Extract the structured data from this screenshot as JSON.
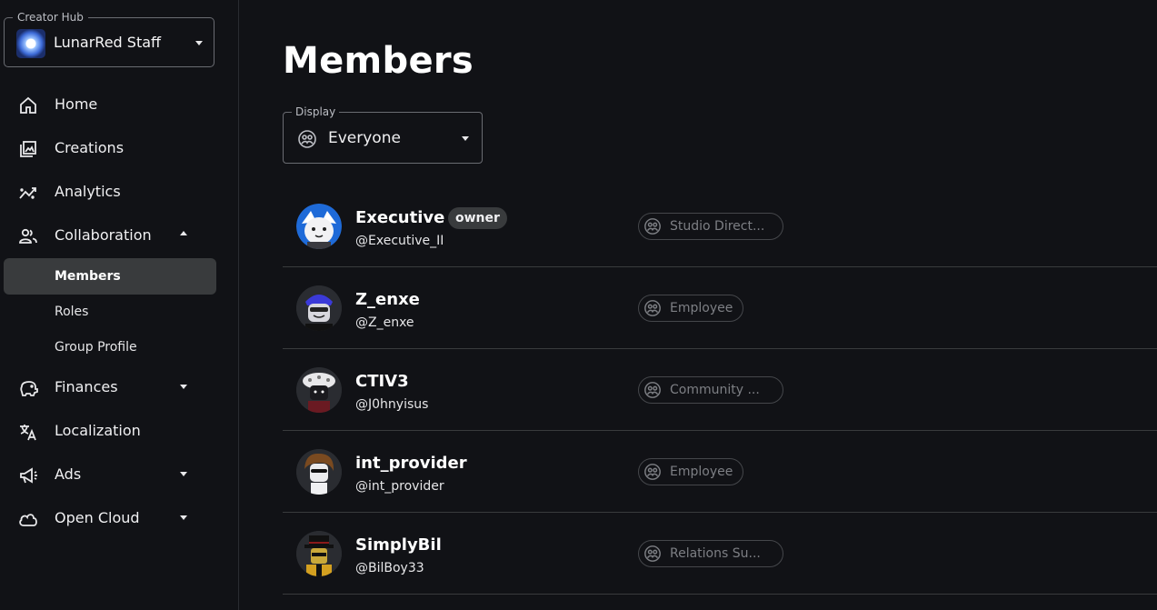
{
  "hub": {
    "legend": "Creator Hub",
    "name": "LunarRed Staff"
  },
  "nav": {
    "home": "Home",
    "creations": "Creations",
    "analytics": "Analytics",
    "collaboration": "Collaboration",
    "members": "Members",
    "roles": "Roles",
    "group_profile": "Group Profile",
    "finances": "Finances",
    "localization": "Localization",
    "ads": "Ads",
    "open_cloud": "Open Cloud"
  },
  "page": {
    "title": "Members"
  },
  "display_filter": {
    "legend": "Display",
    "value": "Everyone"
  },
  "members": [
    {
      "display_name": "Executive",
      "badge": "owner",
      "username": "@Executive_II",
      "role": "Studio Direct..."
    },
    {
      "display_name": "Z_enxe",
      "username": "@Z_enxe",
      "role": "Employee"
    },
    {
      "display_name": "CTIV3",
      "username": "@J0hnyisus",
      "role": "Community ..."
    },
    {
      "display_name": "int_provider",
      "username": "@int_provider",
      "role": "Employee"
    },
    {
      "display_name": "SimplyBil",
      "username": "@BilBoy33",
      "role": "Relations Su..."
    }
  ],
  "colors": {
    "background": "#111216",
    "active_item": "#393b3d",
    "divider": "#393b3d",
    "chip_text": "#7d7f84"
  }
}
